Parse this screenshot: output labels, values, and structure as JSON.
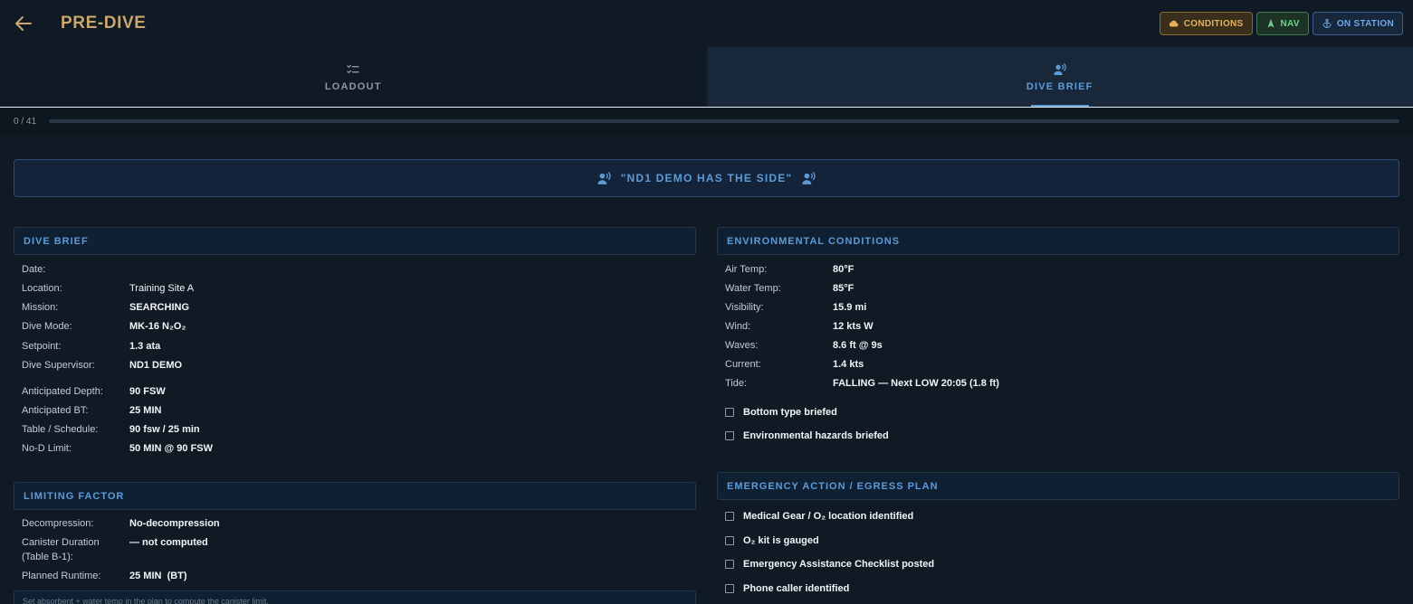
{
  "header": {
    "title": "PRE-DIVE",
    "buttons": {
      "conditions": "CONDITIONS",
      "nav": "NAV",
      "on_station": "ON STATION"
    }
  },
  "tabs": [
    {
      "label": "LOADOUT",
      "icon": "checklist-icon",
      "active": false
    },
    {
      "label": "DIVE BRIEF",
      "icon": "voice-icon",
      "active": true
    }
  ],
  "progress": {
    "text": "0 / 41",
    "done": 0,
    "total": 41
  },
  "banner": {
    "text": "\"ND1 DEMO HAS THE SIDE\""
  },
  "dive_brief": {
    "heading": "DIVE BRIEF",
    "rows_top": [
      {
        "label": "Date:",
        "value": ""
      },
      {
        "label": "Location:",
        "value": "Training Site A"
      },
      {
        "label": "Mission:",
        "value": "SEARCHING"
      },
      {
        "label": "Dive Mode:",
        "value": "MK-16 N₂O₂"
      },
      {
        "label": "Setpoint:",
        "value": "1.3 ata"
      },
      {
        "label": "Dive Supervisor:",
        "value": "ND1 DEMO"
      }
    ],
    "rows_bottom": [
      {
        "label": "Anticipated Depth:",
        "value": "90 FSW"
      },
      {
        "label": "Anticipated BT:",
        "value": "25 MIN"
      },
      {
        "label": "Table / Schedule:",
        "value": "90 fsw / 25 min"
      },
      {
        "label": "No-D Limit:",
        "value": "50 MIN @ 90 FSW"
      }
    ]
  },
  "limiting_factor": {
    "heading": "LIMITING FACTOR",
    "rows": [
      {
        "label": "Decompression:",
        "value": "No-decompression"
      },
      {
        "label": "Canister Duration",
        "label2": "(Table B-1):",
        "value": "— not computed"
      },
      {
        "label": "Planned Runtime:",
        "value": "25 MIN  (BT)"
      }
    ],
    "note": "Set absorbent + water temp in the plan to compute the canister limit."
  },
  "environment": {
    "heading": "ENVIRONMENTAL CONDITIONS",
    "rows": [
      {
        "label": "Air Temp:",
        "value": "80°F"
      },
      {
        "label": "Water Temp:",
        "value": "85°F"
      },
      {
        "label": "Visibility:",
        "value": "15.9 mi"
      },
      {
        "label": "Wind:",
        "value": "12 kts W"
      },
      {
        "label": "Waves:",
        "value": "8.6 ft @ 9s"
      },
      {
        "label": "Current:",
        "value": "1.4 kts"
      },
      {
        "label": "Tide:",
        "value": "FALLING — Next LOW 20:05 (1.8 ft)"
      }
    ],
    "checks": [
      "Bottom type briefed",
      "Environmental hazards briefed"
    ]
  },
  "emergency": {
    "heading": "EMERGENCY ACTION / EGRESS PLAN",
    "checks": [
      "Medical Gear / O₂ location identified",
      "O₂ kit is gauged",
      "Emergency Assistance Checklist posted",
      "Phone caller identified"
    ]
  },
  "colors": {
    "background": "#0f1a24",
    "accent": "#5b9bd8",
    "title": "#c9a66b",
    "conditions": "#e3b35a",
    "nav": "#6fce8a",
    "on_station": "#6ea7e6"
  }
}
